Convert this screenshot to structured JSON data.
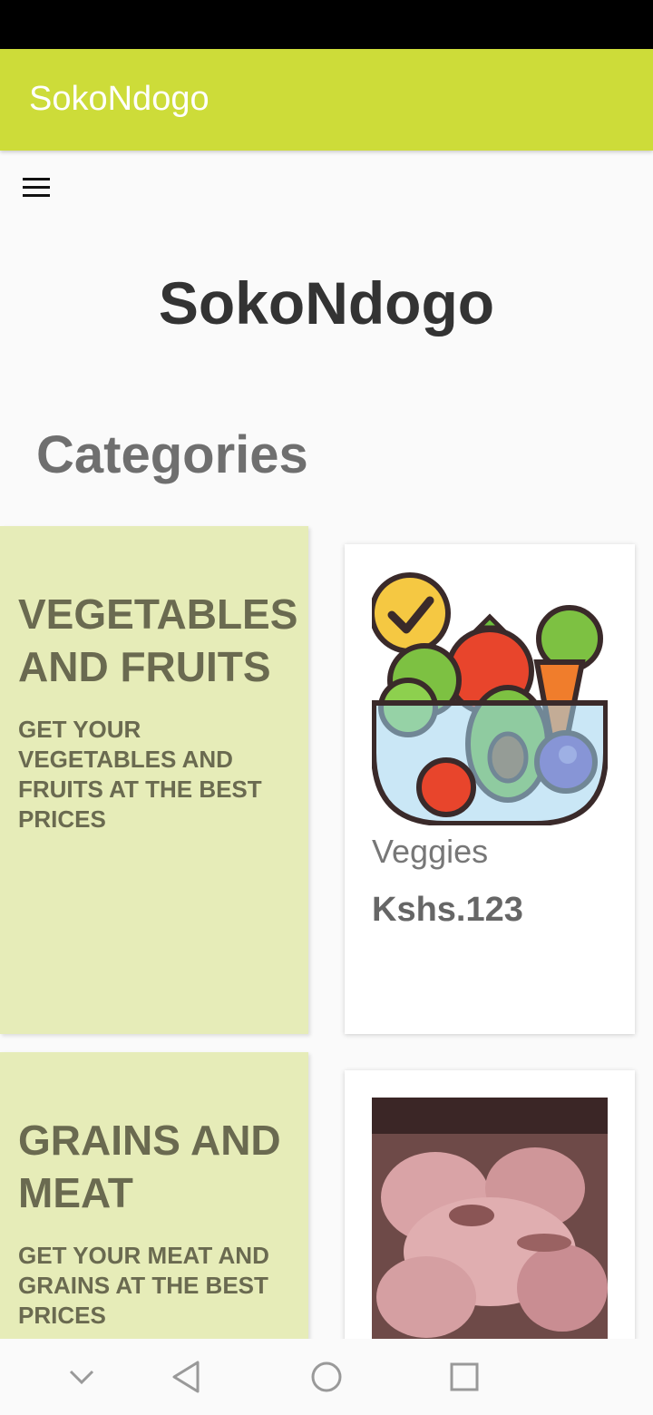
{
  "app_bar": {
    "title": "SokoNdogo",
    "color": "#cddc39"
  },
  "menu": {
    "icon": "hamburger-menu-icon"
  },
  "hero": {
    "title": "SokoNdogo"
  },
  "section": {
    "title": "Categories"
  },
  "categories": [
    {
      "heading": "VEGETABLES AND FRUITS",
      "subtitle": "GET YOUR VEGETABLES AND FRUITS AT THE BEST PRICES",
      "product": {
        "name": "Veggies",
        "price": "Kshs.123",
        "image": "vegetable-basket-image"
      }
    },
    {
      "heading": "GRAINS AND MEAT",
      "subtitle": "GET YOUR MEAT AND GRAINS AT THE BEST PRICES",
      "product": {
        "name": "",
        "price": "",
        "image": "raw-chicken-photo"
      }
    }
  ],
  "nav_bar": {
    "buttons": [
      "chevron-down-icon",
      "back-triangle-icon",
      "home-circle-icon",
      "recents-square-icon"
    ]
  },
  "colors": {
    "panel": "#e6ecb8",
    "panel_text": "#6a6a50",
    "title_text": "#333333"
  }
}
